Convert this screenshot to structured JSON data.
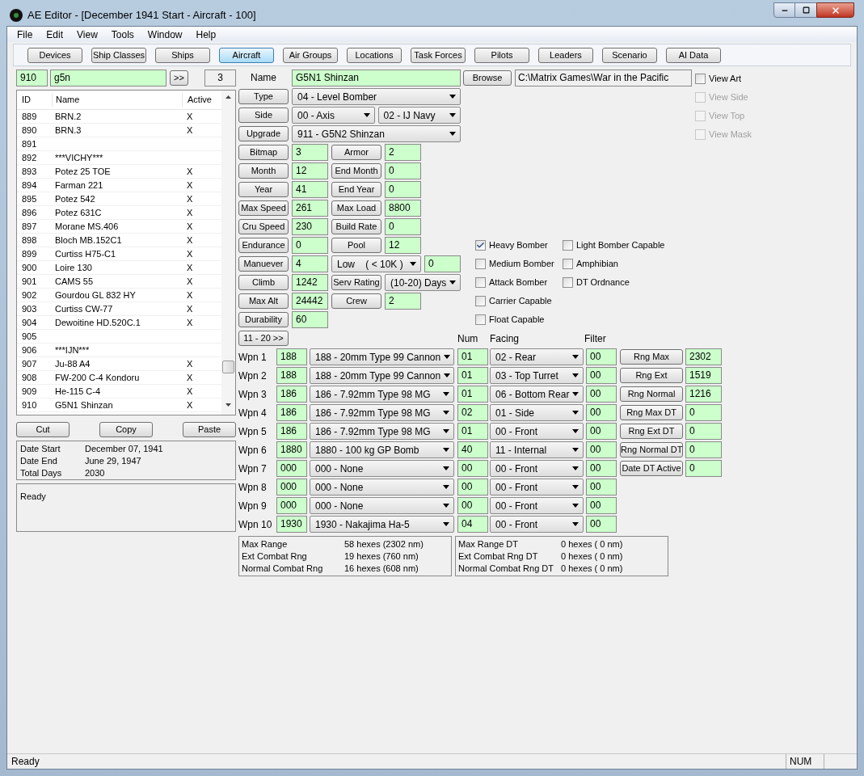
{
  "window": {
    "title": "AE Editor - [December 1941 Start - Aircraft - 100]"
  },
  "menu": [
    "File",
    "Edit",
    "View",
    "Tools",
    "Window",
    "Help"
  ],
  "toolbar": [
    {
      "label": "Devices",
      "selected": false
    },
    {
      "label": "Ship Classes",
      "selected": false
    },
    {
      "label": "Ships",
      "selected": false
    },
    {
      "label": "Aircraft",
      "selected": true
    },
    {
      "label": "Air Groups",
      "selected": false
    },
    {
      "label": "Locations",
      "selected": false
    },
    {
      "label": "Task Forces",
      "selected": false
    },
    {
      "label": "Pilots",
      "selected": false
    },
    {
      "label": "Leaders",
      "selected": false
    },
    {
      "label": "Scenario",
      "selected": false
    },
    {
      "label": "AI Data",
      "selected": false
    }
  ],
  "search": {
    "id": "910",
    "query": "g5n",
    "go_button": ">>",
    "count": "3"
  },
  "list": {
    "columns": [
      "ID",
      "Name",
      "Active"
    ],
    "rows": [
      {
        "id": "889",
        "name": "BRN.2",
        "active": "X"
      },
      {
        "id": "890",
        "name": "BRN.3",
        "active": "X"
      },
      {
        "id": "891"
      },
      {
        "id": "892",
        "name": "***VICHY***"
      },
      {
        "id": "893",
        "name": "Potez 25 TOE",
        "active": "X"
      },
      {
        "id": "894",
        "name": "Farman 221",
        "active": "X"
      },
      {
        "id": "895",
        "name": "Potez 542",
        "active": "X"
      },
      {
        "id": "896",
        "name": "Potez 631C",
        "active": "X"
      },
      {
        "id": "897",
        "name": "Morane MS.406",
        "active": "X"
      },
      {
        "id": "898",
        "name": "Bloch MB.152C1",
        "active": "X"
      },
      {
        "id": "899",
        "name": "Curtiss H75-C1",
        "active": "X"
      },
      {
        "id": "900",
        "name": "Loire 130",
        "active": "X"
      },
      {
        "id": "901",
        "name": "CAMS 55",
        "active": "X"
      },
      {
        "id": "902",
        "name": "Gourdou GL 832 HY",
        "active": "X"
      },
      {
        "id": "903",
        "name": "Curtiss CW-77",
        "active": "X"
      },
      {
        "id": "904",
        "name": "Dewoitine HD.520C.1",
        "active": "X"
      },
      {
        "id": "905"
      },
      {
        "id": "906",
        "name": "***IJN***"
      },
      {
        "id": "907",
        "name": "Ju-88 A4",
        "active": "X"
      },
      {
        "id": "908",
        "name": "FW-200 C-4 Kondoru",
        "active": "X"
      },
      {
        "id": "909",
        "name": "He-115 C-4",
        "active": "X"
      },
      {
        "id": "910",
        "name": "G5N1 Shinzan",
        "active": "X"
      }
    ]
  },
  "edit_buttons": [
    "Cut",
    "Copy",
    "Paste"
  ],
  "dates": [
    {
      "label": "Date Start",
      "value": "December 07, 1941"
    },
    {
      "label": "Date End",
      "value": "June 29, 1947"
    },
    {
      "label": "Total Days",
      "value": "2030"
    }
  ],
  "log": "Ready",
  "form": {
    "rows": [
      [
        {
          "kind": "text",
          "text": "Name"
        },
        {
          "kind": "field",
          "text": "G5N1 Shinzan"
        }
      ],
      [
        {
          "kind": "button",
          "text": "Type"
        },
        {
          "kind": "select",
          "text": "04 - Level Bomber"
        }
      ],
      [
        {
          "kind": "button",
          "text": "Side"
        },
        {
          "kind": "select",
          "text": "00 - Axis"
        },
        {
          "kind": "select",
          "text": "02 - IJ Navy"
        }
      ],
      [
        {
          "kind": "button",
          "text": "Upgrade"
        },
        {
          "kind": "select",
          "text": "911 - G5N2 Shinzan"
        }
      ],
      [
        {
          "kind": "button",
          "text": "Bitmap"
        },
        {
          "kind": "field",
          "text": "3"
        },
        {
          "kind": "button",
          "text": "Armor"
        },
        {
          "kind": "field",
          "text": "2"
        }
      ],
      [
        {
          "kind": "button",
          "text": "Month"
        },
        {
          "kind": "field",
          "text": "12"
        },
        {
          "kind": "button",
          "text": "End Month"
        },
        {
          "kind": "field",
          "text": "0"
        }
      ],
      [
        {
          "kind": "button",
          "text": "Year"
        },
        {
          "kind": "field",
          "text": "41"
        },
        {
          "kind": "button",
          "text": "End Year"
        },
        {
          "kind": "field",
          "text": "0"
        }
      ],
      [
        {
          "kind": "button",
          "text": "Max Speed"
        },
        {
          "kind": "field",
          "text": "261"
        },
        {
          "kind": "button",
          "text": "Max Load"
        },
        {
          "kind": "field",
          "text": "8800"
        }
      ],
      [
        {
          "kind": "button",
          "text": "Cru Speed"
        },
        {
          "kind": "field",
          "text": "230"
        },
        {
          "kind": "button",
          "text": "Build Rate"
        },
        {
          "kind": "field",
          "text": "0"
        }
      ],
      [
        {
          "kind": "button",
          "text": "Endurance"
        },
        {
          "kind": "field",
          "text": "0"
        },
        {
          "kind": "button",
          "text": "Pool"
        },
        {
          "kind": "field",
          "text": "12"
        }
      ],
      [
        {
          "kind": "button",
          "text": "Manuever"
        },
        {
          "kind": "field",
          "text": "4"
        },
        {
          "kind": "select",
          "text": "Low    ( < 10K )"
        },
        {
          "kind": "field",
          "text": "0"
        }
      ],
      [
        {
          "kind": "button",
          "text": "Climb"
        },
        {
          "kind": "field",
          "text": "1242"
        },
        {
          "kind": "button",
          "text": "Serv Rating"
        },
        {
          "kind": "select",
          "text": "(10-20) Days"
        }
      ],
      [
        {
          "kind": "button",
          "text": "Max Alt"
        },
        {
          "kind": "field",
          "text": "24442"
        },
        {
          "kind": "button",
          "text": "Crew"
        },
        {
          "kind": "field",
          "text": "2"
        }
      ],
      [
        {
          "kind": "button",
          "text": "Durability"
        },
        {
          "kind": "field",
          "text": "60"
        }
      ]
    ]
  },
  "browse": {
    "button": "Browse",
    "path": "C:\\Matrix Games\\War in the Pacific"
  },
  "view_options": [
    {
      "label": "View Art",
      "checked": false,
      "disabled": false
    },
    {
      "label": "View Side",
      "checked": false,
      "disabled": true
    },
    {
      "label": "View Top",
      "checked": false,
      "disabled": true
    },
    {
      "label": "View Mask",
      "checked": false,
      "disabled": true
    }
  ],
  "flag_columns": [
    {
      "items": [
        {
          "label": "Heavy Bomber",
          "checked": true
        },
        {
          "label": "Medium Bomber",
          "checked": false
        },
        {
          "label": "Attack Bomber",
          "checked": false
        },
        {
          "label": "Carrier Capable",
          "checked": false
        },
        {
          "label": "Float Capable",
          "checked": false
        }
      ]
    },
    {
      "items": [
        {
          "label": "Light Bomber Capable",
          "checked": false
        },
        {
          "label": "Amphibian",
          "checked": false
        },
        {
          "label": "DT Ordnance",
          "checked": false
        }
      ]
    }
  ],
  "weapons": {
    "page_button": "11 - 20 >>",
    "columns": [
      "Num",
      "Facing",
      "Filter"
    ],
    "rows": [
      {
        "label": "Wpn 1",
        "id": "188",
        "device": "188 - 20mm Type 99 Cannon",
        "num": "01",
        "facing": "02 - Rear",
        "filter": "00"
      },
      {
        "label": "Wpn 2",
        "id": "188",
        "device": "188 - 20mm Type 99 Cannon",
        "num": "01",
        "facing": "03 - Top Turret",
        "filter": "00"
      },
      {
        "label": "Wpn 3",
        "id": "186",
        "device": "186 - 7.92mm Type 98 MG",
        "num": "01",
        "facing": "06 - Bottom Rear",
        "filter": "00"
      },
      {
        "label": "Wpn 4",
        "id": "186",
        "device": "186 - 7.92mm Type 98 MG",
        "num": "02",
        "facing": "01 - Side",
        "filter": "00"
      },
      {
        "label": "Wpn 5",
        "id": "186",
        "device": "186 - 7.92mm Type 98 MG",
        "num": "01",
        "facing": "00 - Front",
        "filter": "00"
      },
      {
        "label": "Wpn 6",
        "id": "1880",
        "device": "1880 - 100 kg GP Bomb",
        "num": "40",
        "facing": "11 - Internal",
        "filter": "00"
      },
      {
        "label": "Wpn 7",
        "id": "000",
        "device": "000 - None",
        "num": "00",
        "facing": "00 - Front",
        "filter": "00"
      },
      {
        "label": "Wpn 8",
        "id": "000",
        "device": "000 - None",
        "num": "00",
        "facing": "00 - Front",
        "filter": "00"
      },
      {
        "label": "Wpn 9",
        "id": "000",
        "device": "000 - None",
        "num": "00",
        "facing": "00 - Front",
        "filter": "00"
      },
      {
        "label": "Wpn 10",
        "id": "1930",
        "device": "1930 - Nakajima Ha-5",
        "num": "04",
        "facing": "00 - Front",
        "filter": "00"
      }
    ]
  },
  "ranges": [
    {
      "label": "Rng Max",
      "value": "2302"
    },
    {
      "label": "Rng Ext",
      "value": "1519"
    },
    {
      "label": "Rng Normal",
      "value": "1216"
    },
    {
      "label": "Rng Max DT",
      "value": "0"
    },
    {
      "label": "Rng Ext DT",
      "value": "0"
    },
    {
      "label": "Rng Normal DT",
      "value": "0"
    },
    {
      "label": "Date DT Active",
      "value": "0"
    }
  ],
  "summary": [
    {
      "items": [
        {
          "label": "Max Range",
          "value": "58 hexes (2302 nm)"
        },
        {
          "label": "Ext Combat Rng",
          "value": "19 hexes (760 nm)"
        },
        {
          "label": "Normal Combat Rng",
          "value": "16 hexes (608 nm)"
        }
      ]
    },
    {
      "items": [
        {
          "label": "Max Range DT",
          "value": "0 hexes ( 0 nm)"
        },
        {
          "label": "Ext Combat Rng DT",
          "value": "0 hexes ( 0 nm)"
        },
        {
          "label": "Normal Combat Rng DT",
          "value": "0 hexes ( 0 nm)"
        }
      ]
    }
  ],
  "status_bar": {
    "text": "Ready",
    "indicator": "NUM"
  }
}
